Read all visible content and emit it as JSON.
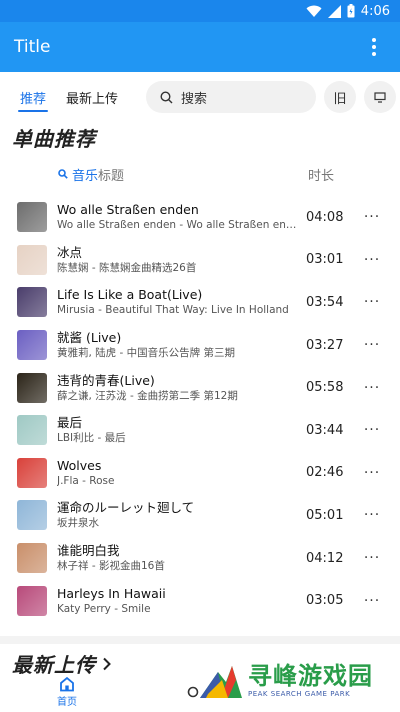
{
  "status_bar": {
    "time": "4:06"
  },
  "app_bar": {
    "title": "Title"
  },
  "tabs": [
    {
      "label": "推荐",
      "active": true
    },
    {
      "label": "最新上传",
      "active": false
    }
  ],
  "search": {
    "placeholder": "搜索"
  },
  "toolbar": {
    "old_label": "旧"
  },
  "recommend": {
    "title": "单曲推荐",
    "header_music": "音乐",
    "header_title": "标题",
    "header_duration": "时长"
  },
  "songs": [
    {
      "name": "Wo alle Straßen enden",
      "desc": "Wo alle Straßen enden - Wo alle Straßen enden",
      "duration": "04:08",
      "more": "···",
      "cover_color": "#6d6d6d"
    },
    {
      "name": "冰点",
      "desc": "陈慧娴 - 陈慧娴金曲精选26首",
      "duration": "03:01",
      "more": "···",
      "cover_color": "#e6d2c4"
    },
    {
      "name": "Life Is Like a Boat(Live)",
      "desc": "Mirusia - Beautiful That Way: Live In Holland",
      "duration": "03:54",
      "more": "···",
      "cover_color": "#4a3d6b"
    },
    {
      "name": "就酱 (Live)",
      "desc": "黄雅莉, 陆虎 - 中国音乐公告牌 第三期",
      "duration": "03:27",
      "more": "···",
      "cover_color": "#6b5fc2"
    },
    {
      "name": "违背的青春(Live)",
      "desc": "薛之谦, 汪苏泷 - 金曲捞第二季 第12期",
      "duration": "05:58",
      "more": "···",
      "cover_color": "#2b2418"
    },
    {
      "name": "最后",
      "desc": "LBI利比 - 最后",
      "duration": "03:44",
      "more": "···",
      "cover_color": "#9fc9c4"
    },
    {
      "name": "Wolves",
      "desc": "J.Fla - Rose",
      "duration": "02:46",
      "more": "···",
      "cover_color": "#d9413a"
    },
    {
      "name": "運命のルーレット廻して",
      "desc": "坂井泉水",
      "duration": "05:01",
      "more": "···",
      "cover_color": "#8fb6d8"
    },
    {
      "name": "谁能明白我",
      "desc": "林子祥 - 影视金曲16首",
      "duration": "04:12",
      "more": "···",
      "cover_color": "#c98f6a"
    },
    {
      "name": "Harleys In Hawaii",
      "desc": "Katy Perry - Smile",
      "duration": "03:05",
      "more": "···",
      "cover_color": "#b84a7a"
    }
  ],
  "latest": {
    "title": "最新上传"
  },
  "bottom_nav": {
    "home_label": "首页"
  },
  "watermark": {
    "cn": "寻峰游戏园",
    "en": "PEAK SEARCH GAME PARK"
  },
  "colors": {
    "primary": "#2196f3",
    "accent": "#1a73e8",
    "watermark_green": "#2a9d4a"
  }
}
